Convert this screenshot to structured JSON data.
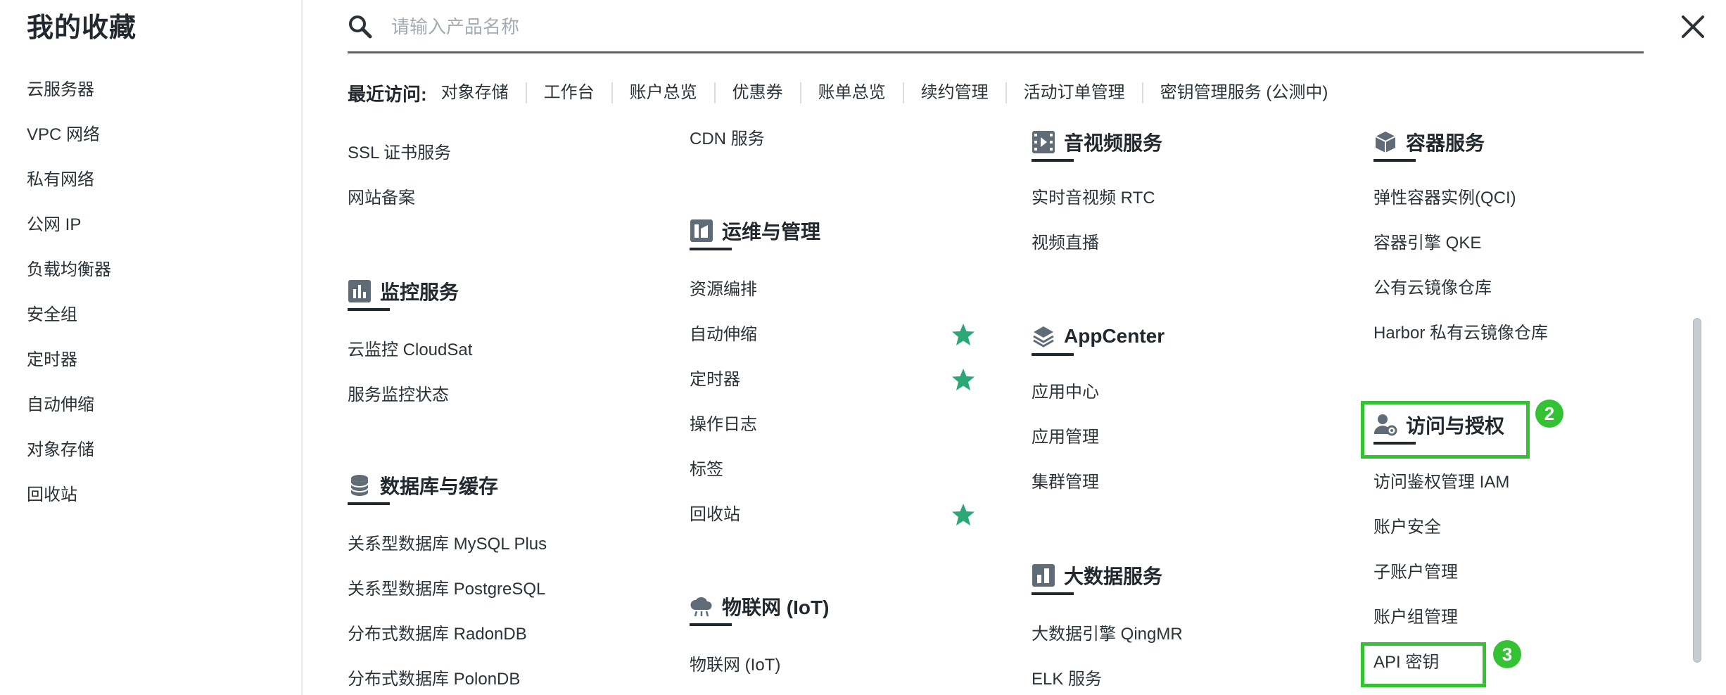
{
  "colors": {
    "accent_green": "#34c234",
    "star_green": "#2aa876",
    "text": "#2c3338",
    "heading": "#22282d"
  },
  "sidebar": {
    "title": "我的收藏",
    "items": [
      "云服务器",
      "VPC 网络",
      "私有网络",
      "公网 IP",
      "负载均衡器",
      "安全组",
      "定时器",
      "自动伸缩",
      "对象存储",
      "回收站"
    ]
  },
  "search": {
    "placeholder": "请输入产品名称",
    "value": "",
    "icon": "search-icon"
  },
  "close_icon": "close-icon",
  "recent": {
    "label": "最近访问:",
    "items": [
      "对象存储",
      "工作台",
      "账户总览",
      "优惠券",
      "账单总览",
      "续约管理",
      "活动订单管理",
      "密钥管理服务 (公测中)"
    ]
  },
  "columns": {
    "col1": {
      "top_items": [
        "SSL 证书服务",
        "网站备案"
      ],
      "monitor": {
        "title": "监控服务",
        "icon": "chart-bars-icon",
        "items": [
          "云监控 CloudSat",
          "服务监控状态"
        ]
      },
      "database": {
        "title": "数据库与缓存",
        "icon": "database-icon",
        "items": [
          "关系型数据库 MySQL Plus",
          "关系型数据库 PostgreSQL",
          "分布式数据库 RadonDB",
          "分布式数据库 PolonDB"
        ]
      }
    },
    "col2": {
      "top_items": [
        "CDN 服务"
      ],
      "ops": {
        "title": "运维与管理",
        "icon": "building-icon",
        "items": [
          "资源编排",
          "自动伸缩",
          "定时器",
          "操作日志",
          "标签",
          "回收站"
        ]
      },
      "iot": {
        "title": "物联网 (IoT)",
        "icon": "cloud-iot-icon",
        "items": [
          "物联网 (IoT)"
        ]
      }
    },
    "col3": {
      "media": {
        "title": "音视频服务",
        "icon": "video-play-icon",
        "items": [
          "实时音视频 RTC",
          "视频直播"
        ]
      },
      "appcenter": {
        "title": "AppCenter",
        "icon": "layers-icon",
        "items": [
          "应用中心",
          "应用管理",
          "集群管理"
        ]
      },
      "bigdata": {
        "title": "大数据服务",
        "icon": "bar-chart-icon",
        "items": [
          "大数据引擎 QingMR",
          "ELK 服务"
        ]
      }
    },
    "col4": {
      "container": {
        "title": "容器服务",
        "icon": "cube-icon",
        "items": [
          "弹性容器实例(QCI)",
          "容器引擎 QKE",
          "公有云镜像仓库",
          "Harbor 私有云镜像仓库"
        ]
      },
      "access": {
        "title": "访问与授权",
        "icon": "user-gear-icon",
        "items": [
          "访问鉴权管理 IAM",
          "账户安全",
          "子账户管理",
          "账户组管理",
          "API 密钥"
        ]
      }
    }
  },
  "favorites": [
    "自动伸缩",
    "定时器",
    "回收站"
  ],
  "annotations": {
    "badge_2": "2",
    "badge_3": "3"
  }
}
